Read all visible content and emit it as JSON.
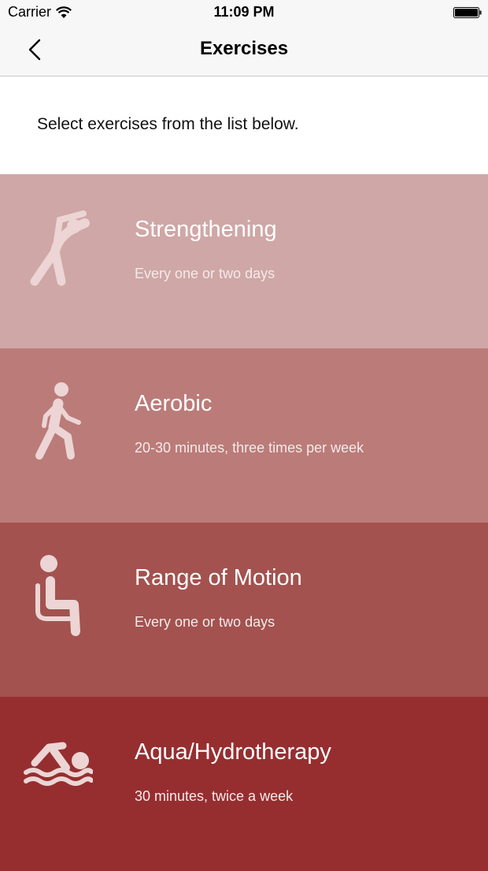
{
  "status_bar": {
    "carrier": "Carrier",
    "time": "11:09 PM"
  },
  "nav": {
    "title": "Exercises"
  },
  "intro": {
    "text": "Select exercises from the list below."
  },
  "exercises": [
    {
      "title": "Strengthening",
      "subtitle": "Every one or two days",
      "color": "#cfa7a6",
      "icon": "stretching-person-icon"
    },
    {
      "title": "Aerobic",
      "subtitle": "20-30 minutes, three times per week",
      "color": "#bb7b79",
      "icon": "walking-person-icon"
    },
    {
      "title": "Range of Motion",
      "subtitle": "Every one or two days",
      "color": "#a3524f",
      "icon": "seated-person-icon"
    },
    {
      "title": "Aqua/Hydrotherapy",
      "subtitle": "30 minutes, twice a week",
      "color": "#962e30",
      "icon": "swimming-person-icon"
    }
  ],
  "colors": {
    "icon_tint": "#ecd5d4",
    "bar_background": "#f7f7f7"
  }
}
